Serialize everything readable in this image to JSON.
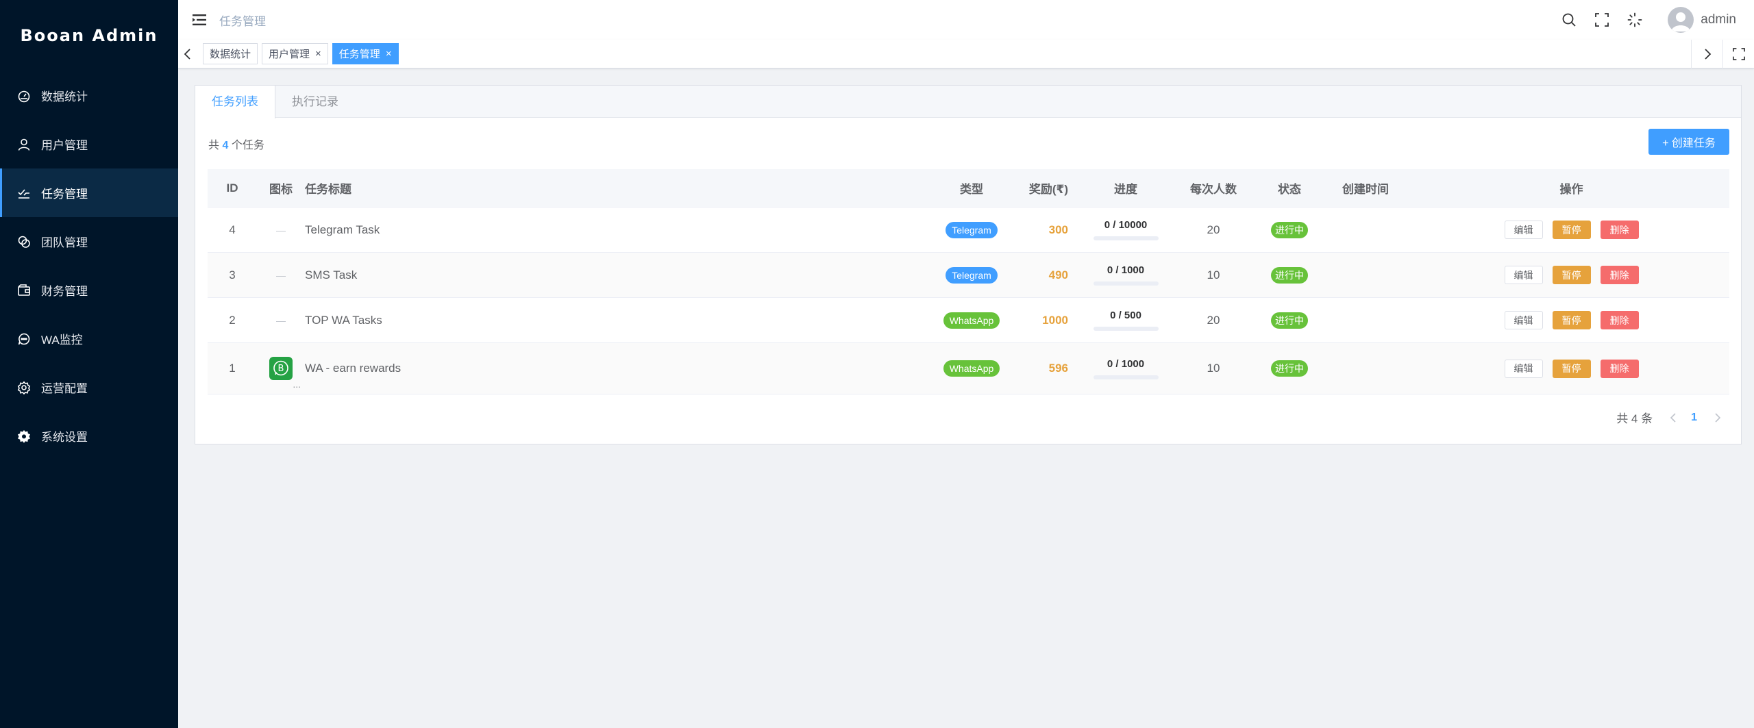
{
  "app": {
    "title": "Booan Admin"
  },
  "sidebar": {
    "items": [
      {
        "label": "数据统计",
        "icon": "dashboard-icon"
      },
      {
        "label": "用户管理",
        "icon": "user-icon"
      },
      {
        "label": "任务管理",
        "icon": "task-icon",
        "active": true
      },
      {
        "label": "团队管理",
        "icon": "team-icon"
      },
      {
        "label": "财务管理",
        "icon": "wallet-icon"
      },
      {
        "label": "WA监控",
        "icon": "chat-icon"
      },
      {
        "label": "运营配置",
        "icon": "settings-icon"
      },
      {
        "label": "系统设置",
        "icon": "gear-icon"
      }
    ]
  },
  "header": {
    "breadcrumb": "任务管理",
    "username": "admin",
    "icons": [
      "search-icon",
      "fullscreen-icon",
      "loading-icon",
      "avatar"
    ]
  },
  "tags": [
    {
      "label": "数据统计",
      "closable": false
    },
    {
      "label": "用户管理",
      "closable": true
    },
    {
      "label": "任务管理",
      "closable": true,
      "active": true
    }
  ],
  "tags_close_glyph": "×",
  "tabs": [
    {
      "label": "任务列表",
      "active": true
    },
    {
      "label": "执行记录"
    }
  ],
  "summary": {
    "prefix": "共",
    "count": "4",
    "suffix": "个任务"
  },
  "create_button": "+ 创建任务",
  "table": {
    "headers": [
      "ID",
      "图标",
      "任务标题",
      "类型",
      "奖励(₹)",
      "进度",
      "每次人数",
      "状态",
      "创建时间",
      "操作"
    ],
    "rows": [
      {
        "id": "4",
        "icon": "—",
        "title": "Telegram Task",
        "type": "Telegram",
        "reward": "300",
        "progress": "0 / 10000",
        "progress_ratio": 0,
        "per": "20",
        "status": "进行中",
        "created": ""
      },
      {
        "id": "3",
        "icon": "—",
        "title": "SMS Task",
        "type": "Telegram",
        "reward": "490",
        "progress": "0 / 1000",
        "progress_ratio": 0,
        "per": "10",
        "status": "进行中",
        "created": ""
      },
      {
        "id": "2",
        "icon": "—",
        "title": "TOP WA Tasks",
        "type": "WhatsApp",
        "reward": "1000",
        "progress": "0 / 500",
        "progress_ratio": 0,
        "per": "20",
        "status": "进行中",
        "created": ""
      },
      {
        "id": "1",
        "icon": "whatsapp-business-icon",
        "icon_suffix": "...",
        "title": "WA - earn rewards",
        "type": "WhatsApp",
        "reward": "596",
        "progress": "0 / 1000",
        "progress_ratio": 0,
        "per": "10",
        "status": "进行中",
        "created": ""
      }
    ],
    "actions": {
      "edit": "编辑",
      "pause": "暂停",
      "delete": "删除"
    }
  },
  "pagination": {
    "total": "共 4 条",
    "current": "1"
  },
  "colors": {
    "sidebar_bg": "#001529",
    "primary": "#409eff",
    "success": "#67c23a",
    "warning": "#e6a23c",
    "danger": "#f56c6c"
  }
}
